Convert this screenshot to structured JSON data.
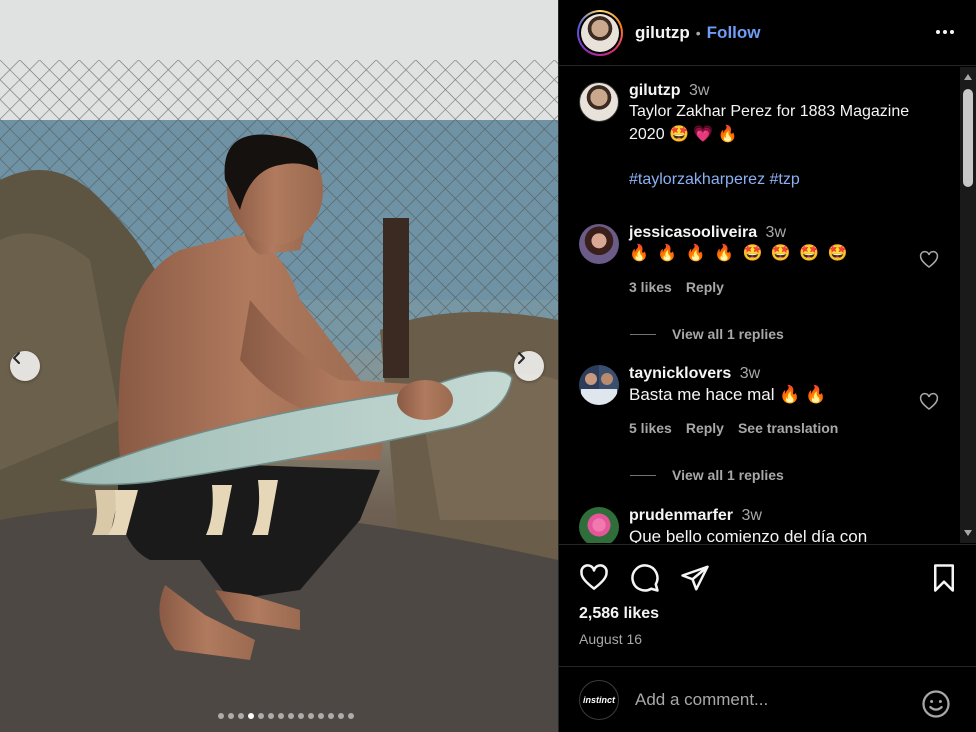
{
  "post": {
    "username": "gilutzp",
    "separator": "•",
    "follow_label": "Follow",
    "more_icon": "more-horizontal-icon"
  },
  "caption": {
    "username": "gilutzp",
    "time": "3w",
    "text": "Taylor Zakhar Perez for 1883 Magazine 2020 🤩 💗 🔥",
    "hashtags": "#taylorzakharperez #tzp"
  },
  "comments": [
    {
      "username": "jessicasooliveira",
      "time": "3w",
      "text": "🔥 🔥 🔥 🔥 🤩 🤩 🤩 🤩",
      "likes": "3 likes",
      "reply": "Reply",
      "view_replies": "View all 1 replies"
    },
    {
      "username": "taynicklovers",
      "time": "3w",
      "text": "Basta me hace mal 🔥 🔥",
      "likes": "5 likes",
      "reply": "Reply",
      "translate": "See translation",
      "view_replies": "View all 1 replies"
    },
    {
      "username": "prudenmarfer",
      "time": "3w",
      "text": "Que bello comienzo del día con"
    }
  ],
  "actions": {
    "likes": "2,586 likes",
    "date": "August 16"
  },
  "add_comment": {
    "avatar_text": "instinct",
    "placeholder": "Add a comment..."
  },
  "carousel": {
    "total_dots": 14,
    "active_index": 3
  },
  "colors": {
    "background": "#000000",
    "link": "#6f9cf5",
    "muted": "#a8a8a8"
  }
}
